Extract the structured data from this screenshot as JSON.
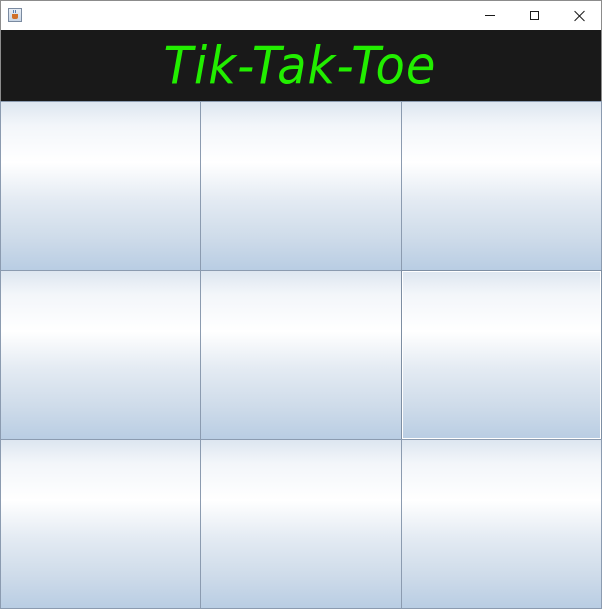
{
  "window": {
    "title": "",
    "icon": "java-cup-icon",
    "controls": {
      "minimize_icon": "minimize-icon",
      "maximize_icon": "maximize-icon",
      "close_icon": "close-icon"
    }
  },
  "header": {
    "title": "Tik-Tak-Toe",
    "title_color": "#22ee00",
    "background": "#191919"
  },
  "board": {
    "rows": 3,
    "cols": 3,
    "cells": [
      "",
      "",
      "",
      "",
      "",
      "",
      "",
      "",
      ""
    ]
  }
}
